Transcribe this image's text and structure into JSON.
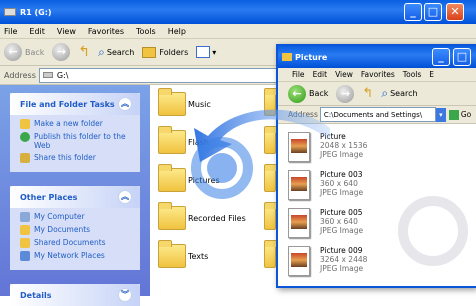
{
  "main_window": {
    "title": "R1 (G:)",
    "menu": [
      "File",
      "Edit",
      "View",
      "Favorites",
      "Tools",
      "Help"
    ],
    "toolbar": {
      "back": "Back",
      "search": "Search",
      "folders": "Folders"
    },
    "address_label": "Address",
    "address_value": "G:\\",
    "tasks": {
      "title": "File and Folder Tasks",
      "items": [
        "Make a new folder",
        "Publish this folder to the Web",
        "Share this folder"
      ]
    },
    "other_places": {
      "title": "Other Places",
      "items": [
        "My Computer",
        "My Documents",
        "Shared Documents",
        "My Network Places"
      ]
    },
    "details": {
      "title": "Details"
    },
    "folders": [
      "Music",
      "Flash",
      "Pictures",
      "Recorded Files",
      "Texts"
    ]
  },
  "picture_window": {
    "title": "Picture",
    "menu": [
      "File",
      "Edit",
      "View",
      "Favorites",
      "Tools",
      "E"
    ],
    "toolbar": {
      "back": "Back",
      "search": "Search"
    },
    "address_label": "Address",
    "address_value": "C:\\Documents and Settings\\",
    "go": "Go",
    "items": [
      {
        "name": "Picture",
        "size": "2048 x 1536",
        "type": "JPEG Image"
      },
      {
        "name": "Picture 003",
        "size": "360 x 640",
        "type": "JPEG Image"
      },
      {
        "name": "Picture 005",
        "size": "360 x 640",
        "type": "JPEG Image"
      },
      {
        "name": "Picture 009",
        "size": "3264 x 2448",
        "type": "JPEG Image"
      }
    ]
  },
  "colors": {
    "xp_blue": "#0a5fe0",
    "task_pane": "#6375d6",
    "drag_arrow": "#3a7fe6"
  }
}
